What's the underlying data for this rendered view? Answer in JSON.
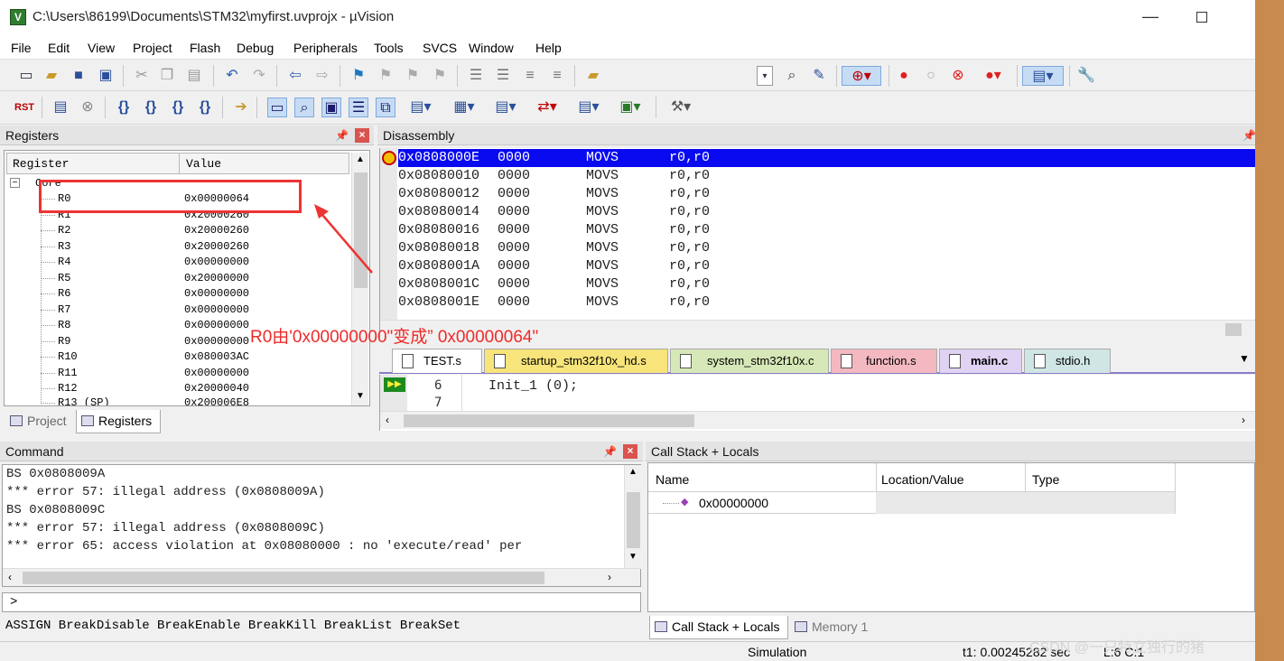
{
  "window": {
    "title": "C:\\Users\\86199\\Documents\\STM32\\myfirst.uvprojx - µVision",
    "minimize_glyph": "—"
  },
  "menu": [
    "File",
    "Edit",
    "View",
    "Project",
    "Flash",
    "Debug",
    "Peripherals",
    "Tools",
    "SVCS",
    "Window",
    "Help"
  ],
  "toolbar_debug": {
    "reset_label": "RST",
    "step_labels": [
      "{}",
      "{}",
      "{}",
      "{}"
    ]
  },
  "registers_panel": {
    "title": "Registers",
    "col_register": "Register",
    "col_value": "Value",
    "group": "Core",
    "rows": [
      {
        "name": "R0",
        "value": "0x00000064"
      },
      {
        "name": "R1",
        "value": "0x20000260"
      },
      {
        "name": "R2",
        "value": "0x20000260"
      },
      {
        "name": "R3",
        "value": "0x20000260"
      },
      {
        "name": "R4",
        "value": "0x00000000"
      },
      {
        "name": "R5",
        "value": "0x20000000"
      },
      {
        "name": "R6",
        "value": "0x00000000"
      },
      {
        "name": "R7",
        "value": "0x00000000"
      },
      {
        "name": "R8",
        "value": "0x00000000"
      },
      {
        "name": "R9",
        "value": "0x00000000"
      },
      {
        "name": "R10",
        "value": "0x080003AC"
      },
      {
        "name": "R11",
        "value": "0x00000000"
      },
      {
        "name": "R12",
        "value": "0x20000040"
      },
      {
        "name": "R13 (SP)",
        "value": "0x200006E8"
      }
    ],
    "tabs": [
      "Project",
      "Registers"
    ]
  },
  "disassembly": {
    "title": "Disassembly",
    "rows": [
      {
        "addr": "0x0808000E",
        "code": "0000",
        "mnemonic": "MOVS",
        "operands": "r0,r0"
      },
      {
        "addr": "0x08080010",
        "code": "0000",
        "mnemonic": "MOVS",
        "operands": "r0,r0"
      },
      {
        "addr": "0x08080012",
        "code": "0000",
        "mnemonic": "MOVS",
        "operands": "r0,r0"
      },
      {
        "addr": "0x08080014",
        "code": "0000",
        "mnemonic": "MOVS",
        "operands": "r0,r0"
      },
      {
        "addr": "0x08080016",
        "code": "0000",
        "mnemonic": "MOVS",
        "operands": "r0,r0"
      },
      {
        "addr": "0x08080018",
        "code": "0000",
        "mnemonic": "MOVS",
        "operands": "r0,r0"
      },
      {
        "addr": "0x0808001A",
        "code": "0000",
        "mnemonic": "MOVS",
        "operands": "r0,r0"
      },
      {
        "addr": "0x0808001C",
        "code": "0000",
        "mnemonic": "MOVS",
        "operands": "r0,r0"
      },
      {
        "addr": "0x0808001E",
        "code": "0000",
        "mnemonic": "MOVS",
        "operands": "r0,r0"
      }
    ]
  },
  "editor": {
    "tabs": [
      {
        "label": "TEST.s",
        "color": "#ffffff"
      },
      {
        "label": "startup_stm32f10x_hd.s",
        "color": "#f7e47a"
      },
      {
        "label": "system_stm32f10x.c",
        "color": "#d7e8b8"
      },
      {
        "label": "function.s",
        "color": "#f3b8c0"
      },
      {
        "label": "main.c",
        "color": "#e0d2f2"
      },
      {
        "label": "stdio.h",
        "color": "#cfe6e4"
      }
    ],
    "active_tab": "main.c",
    "lines": [
      {
        "num": "6",
        "code": "Init_1 (0);"
      },
      {
        "num": "7",
        "code": ""
      }
    ]
  },
  "command": {
    "title": "Command",
    "output": [
      "BS 0x0808009A",
      "*** error 57: illegal address (0x0808009A)",
      "BS 0x0808009C",
      "*** error 57: illegal address (0x0808009C)",
      "*** error 65: access violation at 0x08080000 : no 'execute/read' per"
    ],
    "prompt": ">",
    "hint": "ASSIGN BreakDisable BreakEnable BreakKill BreakList BreakSet"
  },
  "callstack": {
    "title": "Call Stack + Locals",
    "col_name": "Name",
    "col_location": "Location/Value",
    "col_type": "Type",
    "rows": [
      {
        "name": "0x00000000"
      }
    ],
    "tabs": [
      "Call Stack + Locals",
      "Memory 1"
    ]
  },
  "status": {
    "mode": "Simulation",
    "time": "t1: 0.00245282 sec",
    "pos": "L:6 C:1"
  },
  "annotation": {
    "text": "R0由'0x00000000\"变成” 0x00000064\"",
    "color": "#ee2a2a"
  },
  "watermark": "CSDN @一只特立独行的猪"
}
